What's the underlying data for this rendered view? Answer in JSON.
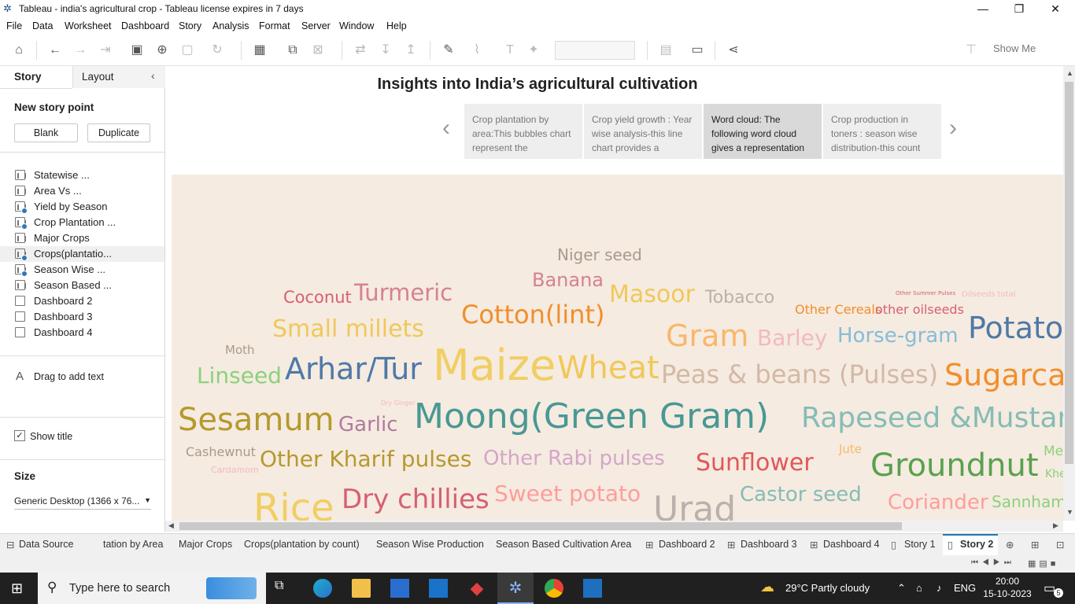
{
  "window": {
    "title": "Tableau - india's agricultural crop - Tableau license expires in 7 days"
  },
  "menu": [
    "File",
    "Data",
    "Worksheet",
    "Dashboard",
    "Story",
    "Analysis",
    "Format",
    "Server",
    "Window",
    "Help"
  ],
  "toolbar": {
    "show_me": "Show Me"
  },
  "sidebar": {
    "tab_story": "Story",
    "tab_layout": "Layout",
    "new_story_point": "New story point",
    "blank": "Blank",
    "duplicate": "Duplicate",
    "sheets": [
      {
        "label": "Statewise ...",
        "type": "chart",
        "used": false
      },
      {
        "label": "Area Vs ...",
        "type": "chart",
        "used": false
      },
      {
        "label": "Yield by Season",
        "type": "chart",
        "used": true
      },
      {
        "label": "Crop Plantation ...",
        "type": "chart",
        "used": true
      },
      {
        "label": "Major Crops",
        "type": "chart",
        "used": false
      },
      {
        "label": "Crops(plantatio...",
        "type": "chart",
        "used": true
      },
      {
        "label": "Season Wise ...",
        "type": "chart",
        "used": true
      },
      {
        "label": "Season Based ...",
        "type": "chart",
        "used": false
      },
      {
        "label": "Dashboard 2",
        "type": "dashboard",
        "used": false
      },
      {
        "label": "Dashboard 3",
        "type": "dashboard",
        "used": false
      },
      {
        "label": "Dashboard 4",
        "type": "dashboard",
        "used": false
      }
    ],
    "drag_text": "Drag to add text",
    "show_title": "Show title",
    "size_label": "Size",
    "size_value": "Generic Desktop (1366 x 76..."
  },
  "story": {
    "title": "Insights into India’s agricultural cultivation",
    "points": [
      {
        "text": "Crop plantation by area:This bubbles chart represent the",
        "selected": false
      },
      {
        "text": "Crop yield growth : Year wise analysis-this line chart provides a",
        "selected": false
      },
      {
        "text": "Word cloud: The following word cloud gives a representation",
        "selected": true
      },
      {
        "text": "Crop production in toners : season wise distribution-this count",
        "selected": false
      }
    ]
  },
  "word_cloud": [
    {
      "text": "Niger seed",
      "size": 20,
      "color": "#a89a8c"
    },
    {
      "text": "Banana",
      "size": 24,
      "color": "#d7818f"
    },
    {
      "text": "Coconut",
      "size": 21,
      "color": "#d66072"
    },
    {
      "text": "Turmeric",
      "size": 29,
      "color": "#d7818f"
    },
    {
      "text": "Masoor",
      "size": 30,
      "color": "#f0c85a"
    },
    {
      "text": "Tobacco",
      "size": 22,
      "color": "#bab0ac"
    },
    {
      "text": "Other Summer Pulses",
      "size": 7,
      "color": "#d66072"
    },
    {
      "text": "Oilseeds total",
      "size": 10,
      "color": "#f4b8c0"
    },
    {
      "text": "Small millets",
      "size": 30,
      "color": "#f0c85a"
    },
    {
      "text": "Cotton(lint)",
      "size": 32,
      "color": "#f28e2b"
    },
    {
      "text": "Other Cereals",
      "size": 16,
      "color": "#f28e2b"
    },
    {
      "text": "other oilseeds",
      "size": 16,
      "color": "#d66072"
    },
    {
      "text": "Moth",
      "size": 15,
      "color": "#a89a8c"
    },
    {
      "text": "Gram",
      "size": 38,
      "color": "#f9b76a"
    },
    {
      "text": "Barley",
      "size": 28,
      "color": "#f4b8c0"
    },
    {
      "text": "Horse-gram",
      "size": 26,
      "color": "#86bcd8"
    },
    {
      "text": "Potato",
      "size": 38,
      "color": "#4e79a7"
    },
    {
      "text": "Linseed",
      "size": 28,
      "color": "#8cd17d"
    },
    {
      "text": "Arhar/Tur",
      "size": 38,
      "color": "#4e79a7"
    },
    {
      "text": "Maize",
      "size": 54,
      "color": "#f1ce63"
    },
    {
      "text": "Wheat",
      "size": 40,
      "color": "#f0c85a"
    },
    {
      "text": "Peas & beans (Pulses)",
      "size": 32,
      "color": "#d4b8a6"
    },
    {
      "text": "Sugarcane",
      "size": 38,
      "color": "#f28e2b"
    },
    {
      "text": "Dry Ginger",
      "size": 8,
      "color": "#f4b8c0"
    },
    {
      "text": "Sesamum",
      "size": 40,
      "color": "#b6992d"
    },
    {
      "text": "Garlic",
      "size": 26,
      "color": "#b07aa1"
    },
    {
      "text": "Moong(Green Gram)",
      "size": 44,
      "color": "#499894"
    },
    {
      "text": "Rapeseed &Mustard",
      "size": 36,
      "color": "#86bcb6"
    },
    {
      "text": "Cashewnut",
      "size": 16,
      "color": "#a89a8c"
    },
    {
      "text": "Other Kharif pulses",
      "size": 28,
      "color": "#b6992d"
    },
    {
      "text": "Other Rabi pulses",
      "size": 26,
      "color": "#d4a6c8"
    },
    {
      "text": "Sunflower",
      "size": 30,
      "color": "#e15759"
    },
    {
      "text": "Jute",
      "size": 15,
      "color": "#f9b76a"
    },
    {
      "text": "Groundnut",
      "size": 40,
      "color": "#59a14f"
    },
    {
      "text": "Mesta",
      "size": 17,
      "color": "#8cd17d"
    },
    {
      "text": "Cardamom",
      "size": 11,
      "color": "#f4b8c0"
    },
    {
      "text": "Khesari",
      "size": 14,
      "color": "#8cd17d"
    },
    {
      "text": "Rice",
      "size": 48,
      "color": "#f1ce63"
    },
    {
      "text": "Dry chillies",
      "size": 34,
      "color": "#d66072"
    },
    {
      "text": "Sweet potato",
      "size": 28,
      "color": "#ff9d9a"
    },
    {
      "text": "Urad",
      "size": 44,
      "color": "#bab0ac"
    },
    {
      "text": "Castor seed",
      "size": 26,
      "color": "#86bcb6"
    },
    {
      "text": "Coriander",
      "size": 26,
      "color": "#ff9d9a"
    },
    {
      "text": "Sannhamp",
      "size": 20,
      "color": "#8cd17d"
    }
  ],
  "bottom_tabs": [
    "Data Source",
    "tation by Area",
    "Major Crops",
    "Crops(plantation by count)",
    "Season Wise Production",
    "Season Based Cultivation Area",
    "Dashboard 2",
    "Dashboard 3",
    "Dashboard 4",
    "Story 1",
    "Story 2"
  ],
  "active_tab": "Story 2",
  "taskbar": {
    "search_placeholder": "Type here to search",
    "weather": "29°C  Partly cloudy",
    "lang": "ENG",
    "time": "20:00",
    "date": "15-10-2023",
    "notifications": "5"
  }
}
